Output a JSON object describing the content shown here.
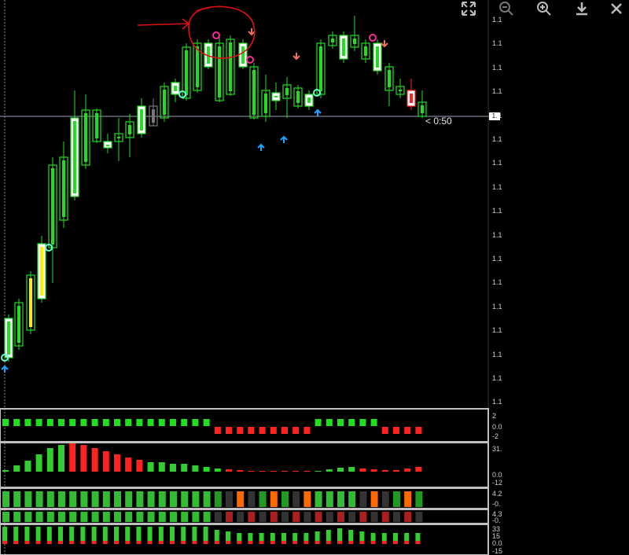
{
  "toolbar": {
    "buttons": [
      {
        "icon": "expand-icon"
      },
      {
        "icon": "zoom-out-icon"
      },
      {
        "icon": "zoom-in-icon"
      },
      {
        "icon": "download-icon"
      },
      {
        "icon": "close-icon"
      }
    ]
  },
  "price_axis": {
    "tick_labels": [
      "1.1",
      "1.1",
      "1.1",
      "1.1",
      "1.1",
      "1.1",
      "1.1",
      "1.1",
      "1.1",
      "1.1",
      "1.1",
      "1.1",
      "1.1",
      "1.1",
      "1.1",
      "1.1",
      "1.1"
    ],
    "last_price_label": "1.",
    "timer": "< 0:50"
  },
  "panes": {
    "pane1": {
      "ticks": [
        "2",
        "0.0",
        "-2"
      ]
    },
    "pane2": {
      "ticks": [
        "31.",
        "0.0",
        "-12"
      ]
    },
    "pane3": {
      "ticks": [
        "4.2",
        "-0.",
        "4.3",
        "-0."
      ]
    },
    "pane4": {
      "ticks": [
        "33",
        "15",
        "0.0",
        "-15"
      ]
    }
  },
  "colors": {
    "bull": "#22dd22",
    "bear": "#ff2222",
    "neutral": "#777777",
    "arrow_up": "#1aa3ff",
    "arrow_down": "#f07060",
    "annotation": "#e01010"
  },
  "chart_data": {
    "type": "candlestick",
    "bars": 38,
    "annotations": [
      "circled-top-region"
    ],
    "signals_up_index": [
      0,
      22,
      23,
      27
    ],
    "signals_down_index": [
      21,
      25,
      33
    ]
  }
}
